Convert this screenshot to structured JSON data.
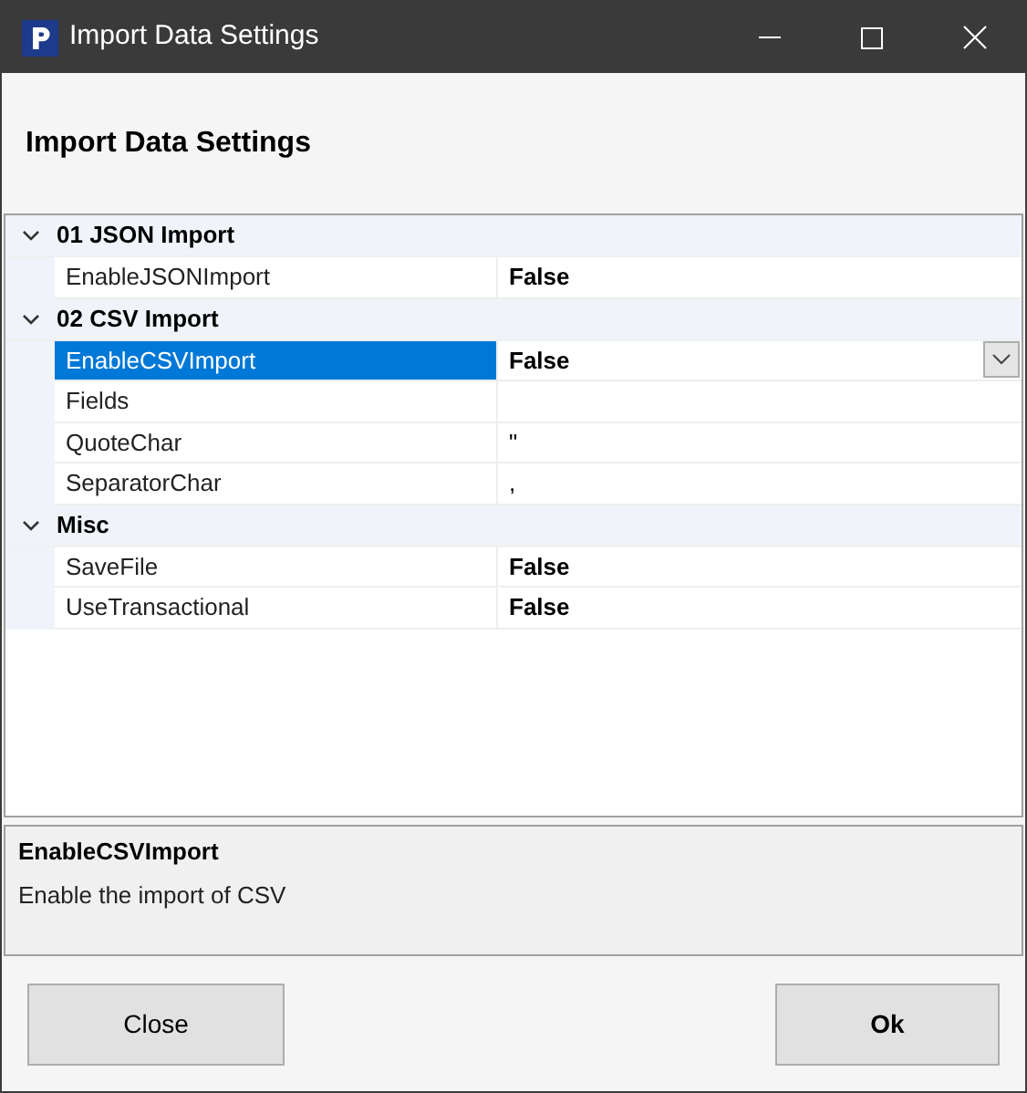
{
  "window": {
    "title": "Import Data Settings"
  },
  "heading": "Import Data Settings",
  "categories": [
    {
      "name": "01 JSON Import",
      "expanded": true,
      "properties": [
        {
          "name": "EnableJSONImport",
          "value": "False",
          "bold": true,
          "selected": false
        }
      ]
    },
    {
      "name": "02 CSV Import",
      "expanded": true,
      "properties": [
        {
          "name": "EnableCSVImport",
          "value": "False",
          "bold": true,
          "selected": true
        },
        {
          "name": "Fields",
          "selected": false
        },
        {
          "name": "QuoteChar",
          "value": "\"",
          "bold": false,
          "selected": false
        },
        {
          "name": "SeparatorChar",
          "value": ",",
          "bold": false,
          "selected": false
        }
      ]
    },
    {
      "name": "Misc",
      "expanded": true,
      "properties": [
        {
          "name": "SaveFile",
          "value": "False",
          "bold": true,
          "selected": false
        },
        {
          "name": "UseTransactional",
          "value": "False",
          "bold": true,
          "selected": false
        }
      ]
    }
  ],
  "description": {
    "title": "EnableCSVImport",
    "text": "Enable the import of CSV"
  },
  "buttons": [
    {
      "label": "Close",
      "kind": "normal"
    },
    {
      "label": "Ok",
      "kind": "default"
    }
  ]
}
